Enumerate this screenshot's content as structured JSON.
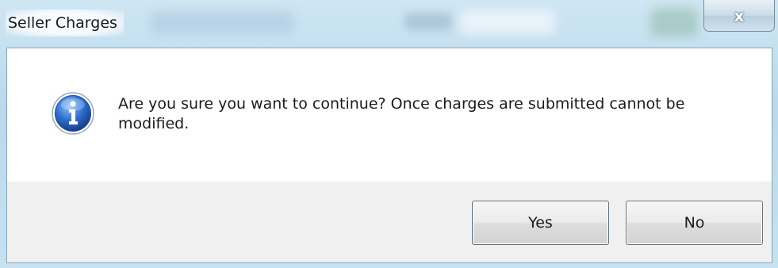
{
  "window": {
    "title": "Seller Charges",
    "close_glyph": "x"
  },
  "dialog": {
    "icon": "info-icon",
    "message": "Are you sure you want to continue? Once charges are submitted cannot be modified."
  },
  "buttons": {
    "yes_label": "Yes",
    "no_label": "No"
  },
  "colors": {
    "titlebar_bg": "#c6e1f1",
    "button_area_bg": "#f0f0f0",
    "icon_blue": "#2b6cc4"
  }
}
